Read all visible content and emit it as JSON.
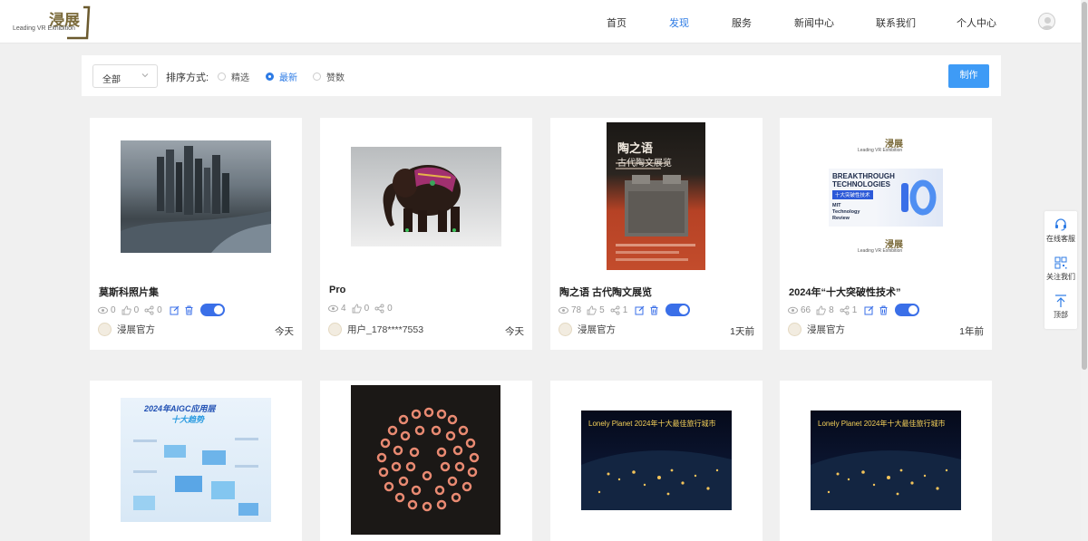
{
  "header": {
    "logo_zh": "浸展",
    "logo_en": "Leading  VR  Exhibition",
    "nav": [
      "首页",
      "发现",
      "服务",
      "新闻中心",
      "联系我们",
      "个人中心"
    ],
    "active_nav": "发现"
  },
  "filter": {
    "category": "全部",
    "sort_label": "排序方式:",
    "options": [
      "精选",
      "最新",
      "赞数"
    ],
    "selected": "最新",
    "make_button": "制作"
  },
  "cards": [
    {
      "title": "莫斯科照片集",
      "views": "0",
      "likes": "0",
      "shares": "0",
      "author": "浸展官方",
      "time": "今天"
    },
    {
      "title": "Pro",
      "views": "4",
      "likes": "0",
      "shares": "0",
      "author": "用户_178****7553",
      "time": "今天"
    },
    {
      "title": "陶之语 古代陶文展览",
      "views": "78",
      "likes": "5",
      "shares": "1",
      "author": "浸展官方",
      "time": "1天前",
      "poster": {
        "title": "陶之语",
        "subtitle": "古代陶文展览"
      }
    },
    {
      "title": "2024年“十大突破性技术”",
      "views": "66",
      "likes": "8",
      "shares": "1",
      "author": "浸展官方",
      "time": "1年前",
      "banner": {
        "line1": "BREAKTHROUGH",
        "line2": "TECHNOLOGIES",
        "tag": "十大突破性技术",
        "brand1": "MIT",
        "brand2": "Technology",
        "brand3": "Review"
      }
    }
  ],
  "row2": {
    "aigc_title": "2024年AIGC应用层",
    "aigc_subtitle": "十大趋势",
    "earth_caption": "Lonely Planet 2024年十大最佳旅行城市"
  },
  "side_panel": {
    "service": "在线客服",
    "follow": "关注我们",
    "top": "顶部"
  },
  "colors": {
    "accent": "#2d7be5",
    "button": "#3e9bf6",
    "toggle": "#3a6fe8"
  }
}
